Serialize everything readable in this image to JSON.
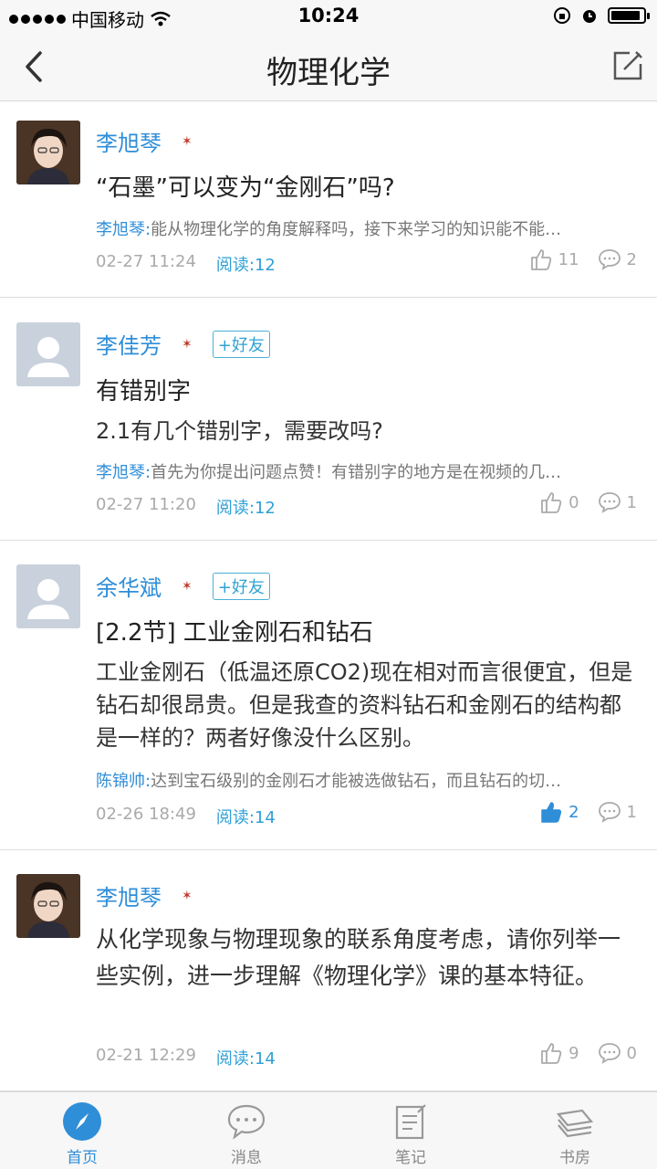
{
  "status_bar": {
    "carrier": "中国移动",
    "time": "10:24",
    "battery_level": 0.92
  },
  "nav": {
    "title": "物理化学",
    "back_icon": "chevron-left-icon",
    "edit_icon": "edit-icon"
  },
  "posts": [
    {
      "author": "李旭琴",
      "title": "“石墨”可以变为“金刚石”吗?",
      "reply_name": "李旭琴:",
      "reply_text": "能从物理化学的角度解释吗，接下来学习的知识能不能…",
      "date": "02-27 11:24",
      "reads": "阅读:12",
      "likes": "11",
      "comments": "2"
    },
    {
      "author": "李佳芳",
      "friend": "+好友",
      "title": "有错别字",
      "body": "2.1有几个错别字，需要改吗?",
      "reply_name": "李旭琴:",
      "reply_text": "首先为你提出问题点赞！有错别字的地方是在视频的几…",
      "date": "02-27 11:20",
      "reads": "阅读:12",
      "likes": "0",
      "comments": "1"
    },
    {
      "author": "余华斌",
      "friend": "+好友",
      "title": "[2.2节] 工业金刚石和钻石",
      "body": "工业金刚石（低温还原CO2)现在相对而言很便宜，但是钻石却很昂贵。但是我查的资料钻石和金刚石的结构都是一样的？两者好像没什么区别。",
      "reply_name": "陈锦帅:",
      "reply_text": "达到宝石级别的金刚石才能被选做钻石，而且钻石的切…",
      "date": "02-26 18:49",
      "reads": "阅读:14",
      "likes": "2",
      "comments": "1"
    },
    {
      "author": "李旭琴",
      "body": "从化学现象与物理现象的联系角度考虑，请你列举一些实例，进一步理解《物理化学》课的基本特征。",
      "date": "02-21 12:29",
      "reads": "阅读:14",
      "likes": "9",
      "comments": "0"
    }
  ],
  "tabs": [
    {
      "label": "首页",
      "icon": "compass-icon"
    },
    {
      "label": "消息",
      "icon": "chat-bubble-icon"
    },
    {
      "label": "笔记",
      "icon": "notebook-icon"
    },
    {
      "label": "书房",
      "icon": "books-icon"
    }
  ],
  "colors": {
    "accent": "#2f8ed8",
    "meta": "#aaaaaa",
    "friend": "#2fa3d2"
  }
}
